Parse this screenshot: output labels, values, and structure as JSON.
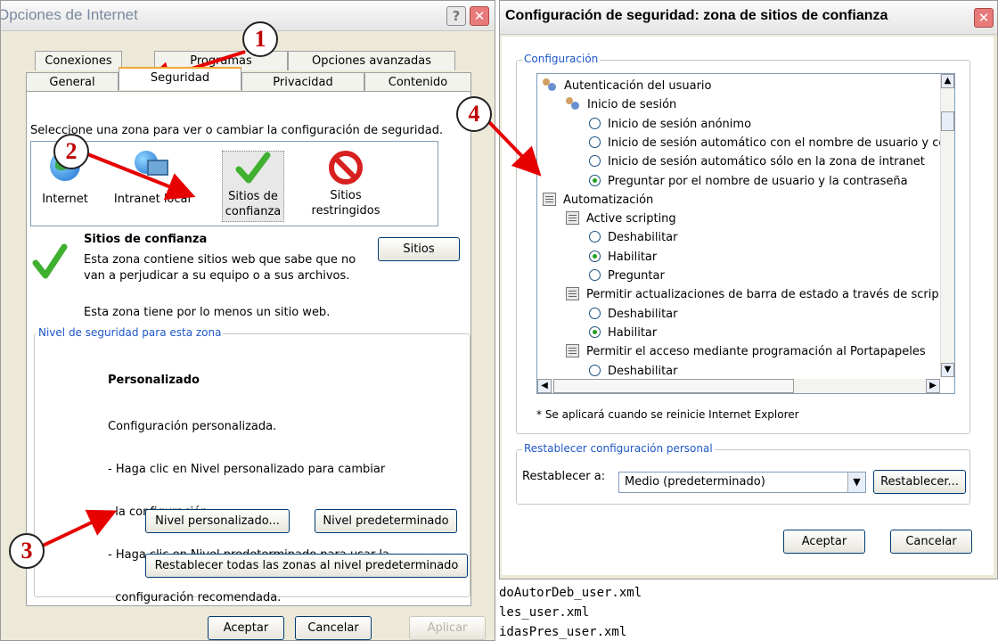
{
  "left_window": {
    "title": "Opciones de Internet",
    "tabs_back": [
      "Conexiones",
      "Programas",
      "Opciones avanzadas"
    ],
    "tabs_front": [
      "General",
      "Seguridad",
      "Privacidad",
      "Contenido"
    ],
    "zones_prompt": "Seleccione una zona para ver o cambiar la configuración de seguridad.",
    "zones": [
      {
        "label": "Internet"
      },
      {
        "label": "Intranet local"
      },
      {
        "label": "Sitios de\nconfianza"
      },
      {
        "label": "Sitios\nrestringidos"
      }
    ],
    "zone_info": {
      "title": "Sitios de confianza",
      "desc": "Esta zona contiene sitios web que sabe que no van a perjudicar a su equipo o a sus archivos.",
      "note": "Esta zona tiene por lo menos un sitio web."
    },
    "sitios_button": "Sitios",
    "level_group": "Nivel de seguridad para esta zona",
    "level": {
      "title": "Personalizado",
      "lines": [
        "Configuración personalizada.",
        "- Haga clic en Nivel personalizado para cambiar",
        "  la configuración",
        "- Haga clic en Nivel predeterminado para usar la",
        "  configuración recomendada."
      ]
    },
    "custom_button": "Nivel personalizado...",
    "default_button": "Nivel predeterminado",
    "reset_all_button": "Restablecer todas las zonas al nivel predeterminado",
    "ok": "Aceptar",
    "cancel": "Cancelar",
    "apply": "Aplicar"
  },
  "right_window": {
    "title": "Configuración de seguridad: zona de sitios de confianza",
    "group": "Configuración",
    "tree": [
      {
        "icon": "users",
        "indent": 0,
        "text": "Autenticación del usuario"
      },
      {
        "icon": "users",
        "indent": 1,
        "text": "Inicio de sesión"
      },
      {
        "icon": "radio",
        "indent": 2,
        "text": "Inicio de sesión anónimo",
        "on": false
      },
      {
        "icon": "radio",
        "indent": 2,
        "text": "Inicio de sesión automático con el nombre de usuario y co",
        "on": false
      },
      {
        "icon": "radio",
        "indent": 2,
        "text": "Inicio de sesión automático sólo en la zona de intranet",
        "on": false
      },
      {
        "icon": "radio",
        "indent": 2,
        "text": "Preguntar por el nombre de usuario y la contraseña",
        "on": true
      },
      {
        "icon": "doc",
        "indent": 0,
        "text": "Automatización"
      },
      {
        "icon": "doc",
        "indent": 1,
        "text": "Active scripting"
      },
      {
        "icon": "radio",
        "indent": 2,
        "text": "Deshabilitar",
        "on": false
      },
      {
        "icon": "radio",
        "indent": 2,
        "text": "Habilitar",
        "on": true
      },
      {
        "icon": "radio",
        "indent": 2,
        "text": "Preguntar",
        "on": false
      },
      {
        "icon": "doc",
        "indent": 1,
        "text": "Permitir actualizaciones de barra de estado a través de scrip"
      },
      {
        "icon": "radio",
        "indent": 2,
        "text": "Deshabilitar",
        "on": false
      },
      {
        "icon": "radio",
        "indent": 2,
        "text": "Habilitar",
        "on": true
      },
      {
        "icon": "doc",
        "indent": 1,
        "text": "Permitir el acceso mediante programación al Portapapeles"
      },
      {
        "icon": "radio",
        "indent": 2,
        "text": "Deshabilitar",
        "on": false
      }
    ],
    "restart_note": "* Se aplicará cuando se reinicie Internet Explorer",
    "reset_group": "Restablecer configuración personal",
    "reset_label": "Restablecer a:",
    "reset_value": "Medio (predeterminado)",
    "reset_button": "Restablecer...",
    "ok": "Aceptar",
    "cancel": "Cancelar"
  },
  "background_files": [
    "doAutorDeb_user.xml",
    "les_user.xml",
    "idasPres_user.xml"
  ],
  "annotations": [
    "1",
    "2",
    "3",
    "4"
  ],
  "colors": {
    "arrow": "#e60000",
    "legend": "#1d57c9",
    "tab_highlight": "#f4a534",
    "selected_radio": "#21a121"
  }
}
